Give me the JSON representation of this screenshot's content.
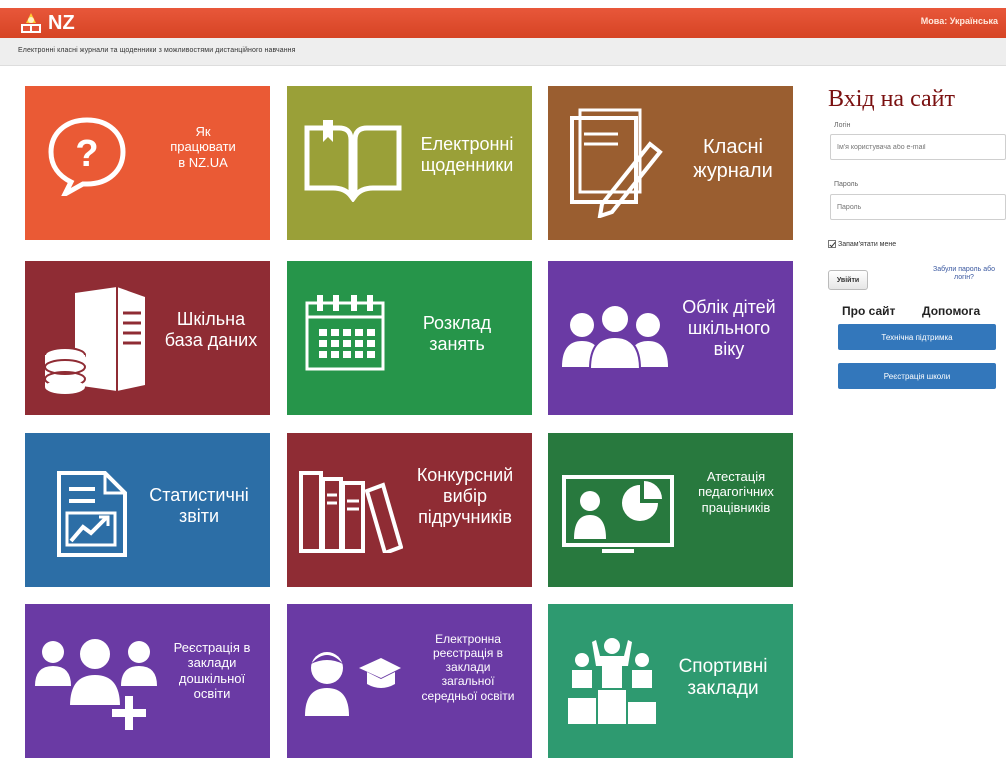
{
  "header": {
    "logo_icon": "nz-book-logo-icon",
    "brand": "NZ",
    "language": "Мова: Українська"
  },
  "subheader": {
    "tagline": "Електронні класні журнали та щоденники з можливостями дистанційного навчання"
  },
  "tiles": [
    {
      "id": "how-to",
      "label": "Як\nпрацювати\nв NZ.UA",
      "color": "#ea5a35",
      "icon": "question-bubble-icon"
    },
    {
      "id": "diaries",
      "label": "Електронні\nщоденники",
      "color": "#9aa038",
      "icon": "open-book-icon"
    },
    {
      "id": "journals",
      "label": "Класні\nжурнали",
      "color": "#9a5e30",
      "icon": "notebook-pencil-icon"
    },
    {
      "id": "school-db",
      "label": "Шкільна\nбаза даних",
      "color": "#8f2c34",
      "icon": "server-database-icon"
    },
    {
      "id": "schedule",
      "label": "Розклад\nзанять",
      "color": "#26954a",
      "icon": "calendar-icon"
    },
    {
      "id": "children",
      "label": "Облік дітей\nшкільного\nвіку",
      "color": "#6a3aa4",
      "icon": "people-group-icon"
    },
    {
      "id": "stats",
      "label": "Статистичні\nзвіти",
      "color": "#2c6ea6",
      "icon": "report-chart-icon"
    },
    {
      "id": "textbooks",
      "label": "Конкурсний\nвибір\nпідручників",
      "color": "#8f2c34",
      "icon": "books-icon"
    },
    {
      "id": "attestation",
      "label": "Атестація\nпедагогічних\nпрацівників",
      "color": "#28793e",
      "icon": "presentation-screen-icon"
    },
    {
      "id": "preschool",
      "label": "Реєстрація в\nзаклади\nдошкільної\nосвіти",
      "color": "#6a3aa4",
      "icon": "add-people-icon"
    },
    {
      "id": "school-reg",
      "label": "Електронна\nреєстрація в\nзаклади\nзагальної\nсередньої освіти",
      "color": "#6a3aa4",
      "icon": "graduate-icon"
    },
    {
      "id": "sports",
      "label": "Спортивні\nзаклади",
      "color": "#2e9a70",
      "icon": "podium-winners-icon"
    }
  ],
  "login": {
    "title": "Вхід на сайт",
    "login_label": "Логін",
    "login_placeholder": "Ім'я користувача або e-mail",
    "password_label": "Пароль",
    "password_placeholder": "Пароль",
    "remember": "Запам'ятати мене",
    "signin": "Увійти",
    "forgot": "Забули пароль або логін?",
    "about": "Про сайт",
    "help": "Допомога",
    "support": "Технічна підтримка",
    "register_school": "Реєстрація школи"
  }
}
